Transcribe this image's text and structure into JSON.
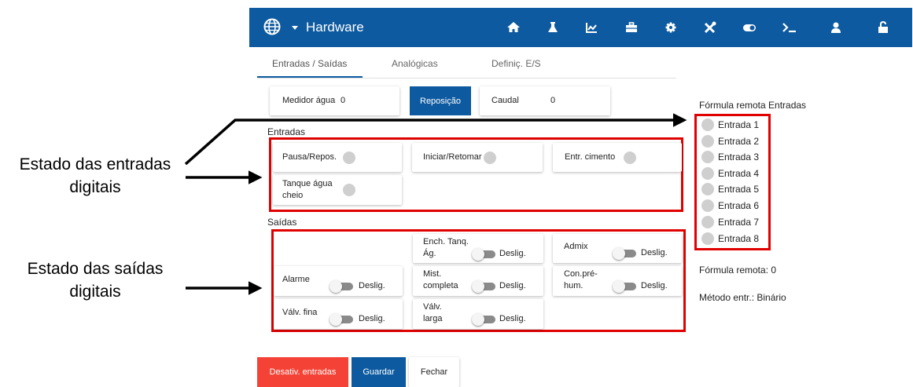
{
  "header": {
    "title": "Hardware"
  },
  "tabs": [
    {
      "label": "Entradas / Saídas"
    },
    {
      "label": "Analógicas"
    },
    {
      "label": "Definiç. E/S"
    }
  ],
  "meter": {
    "water_label": "Medidor água",
    "water_value": "0",
    "reset_label": "Reposição",
    "flow_label": "Caudal",
    "flow_value": "0"
  },
  "inputs": {
    "title": "Entradas",
    "items": [
      "Pausa/Repos.",
      "Iniciar/Retomar",
      "Entr. cimento",
      "Tanque água cheio"
    ]
  },
  "outputs": {
    "title": "Saídas",
    "items": [
      {
        "label": "Ench. Tanq. Ág.",
        "state": "Deslig."
      },
      {
        "label": "Admix",
        "state": "Deslig."
      },
      {
        "label": "Alarme",
        "state": "Deslig."
      },
      {
        "label": "Mist. completa",
        "state": "Deslig."
      },
      {
        "label": "Con.pré-hum.",
        "state": "Deslig."
      },
      {
        "label": "Válv. fina",
        "state": "Deslig."
      },
      {
        "label": "Válv. larga",
        "state": "Deslig."
      }
    ]
  },
  "remote": {
    "title": "Fórmula remota Entradas",
    "entries": [
      "Entrada 1",
      "Entrada 2",
      "Entrada 3",
      "Entrada 4",
      "Entrada 5",
      "Entrada 6",
      "Entrada 7",
      "Entrada 8"
    ],
    "formula_text": "Fórmula remota: 0",
    "method_text": "Método entr.: Binário"
  },
  "footer": {
    "disable_label": "Desativ. entradas",
    "save_label": "Guardar",
    "close_label": "Fechar"
  },
  "callouts": {
    "inputs_line1": "Estado das entradas",
    "inputs_line2": "digitais",
    "outputs_line1": "Estado das saídas",
    "outputs_line2": "digitais"
  },
  "colors": {
    "header_bg": "#0d5aa0",
    "accent": "#0d5aa0",
    "danger": "#f44336",
    "highlight_box": "#e00000"
  },
  "icons": [
    "globe-icon",
    "home-icon",
    "flask-icon",
    "chart-icon",
    "toolbox-icon",
    "gear-icon",
    "tools-icon",
    "toggle-icon",
    "terminal-icon",
    "user-icon",
    "unlock-icon"
  ]
}
